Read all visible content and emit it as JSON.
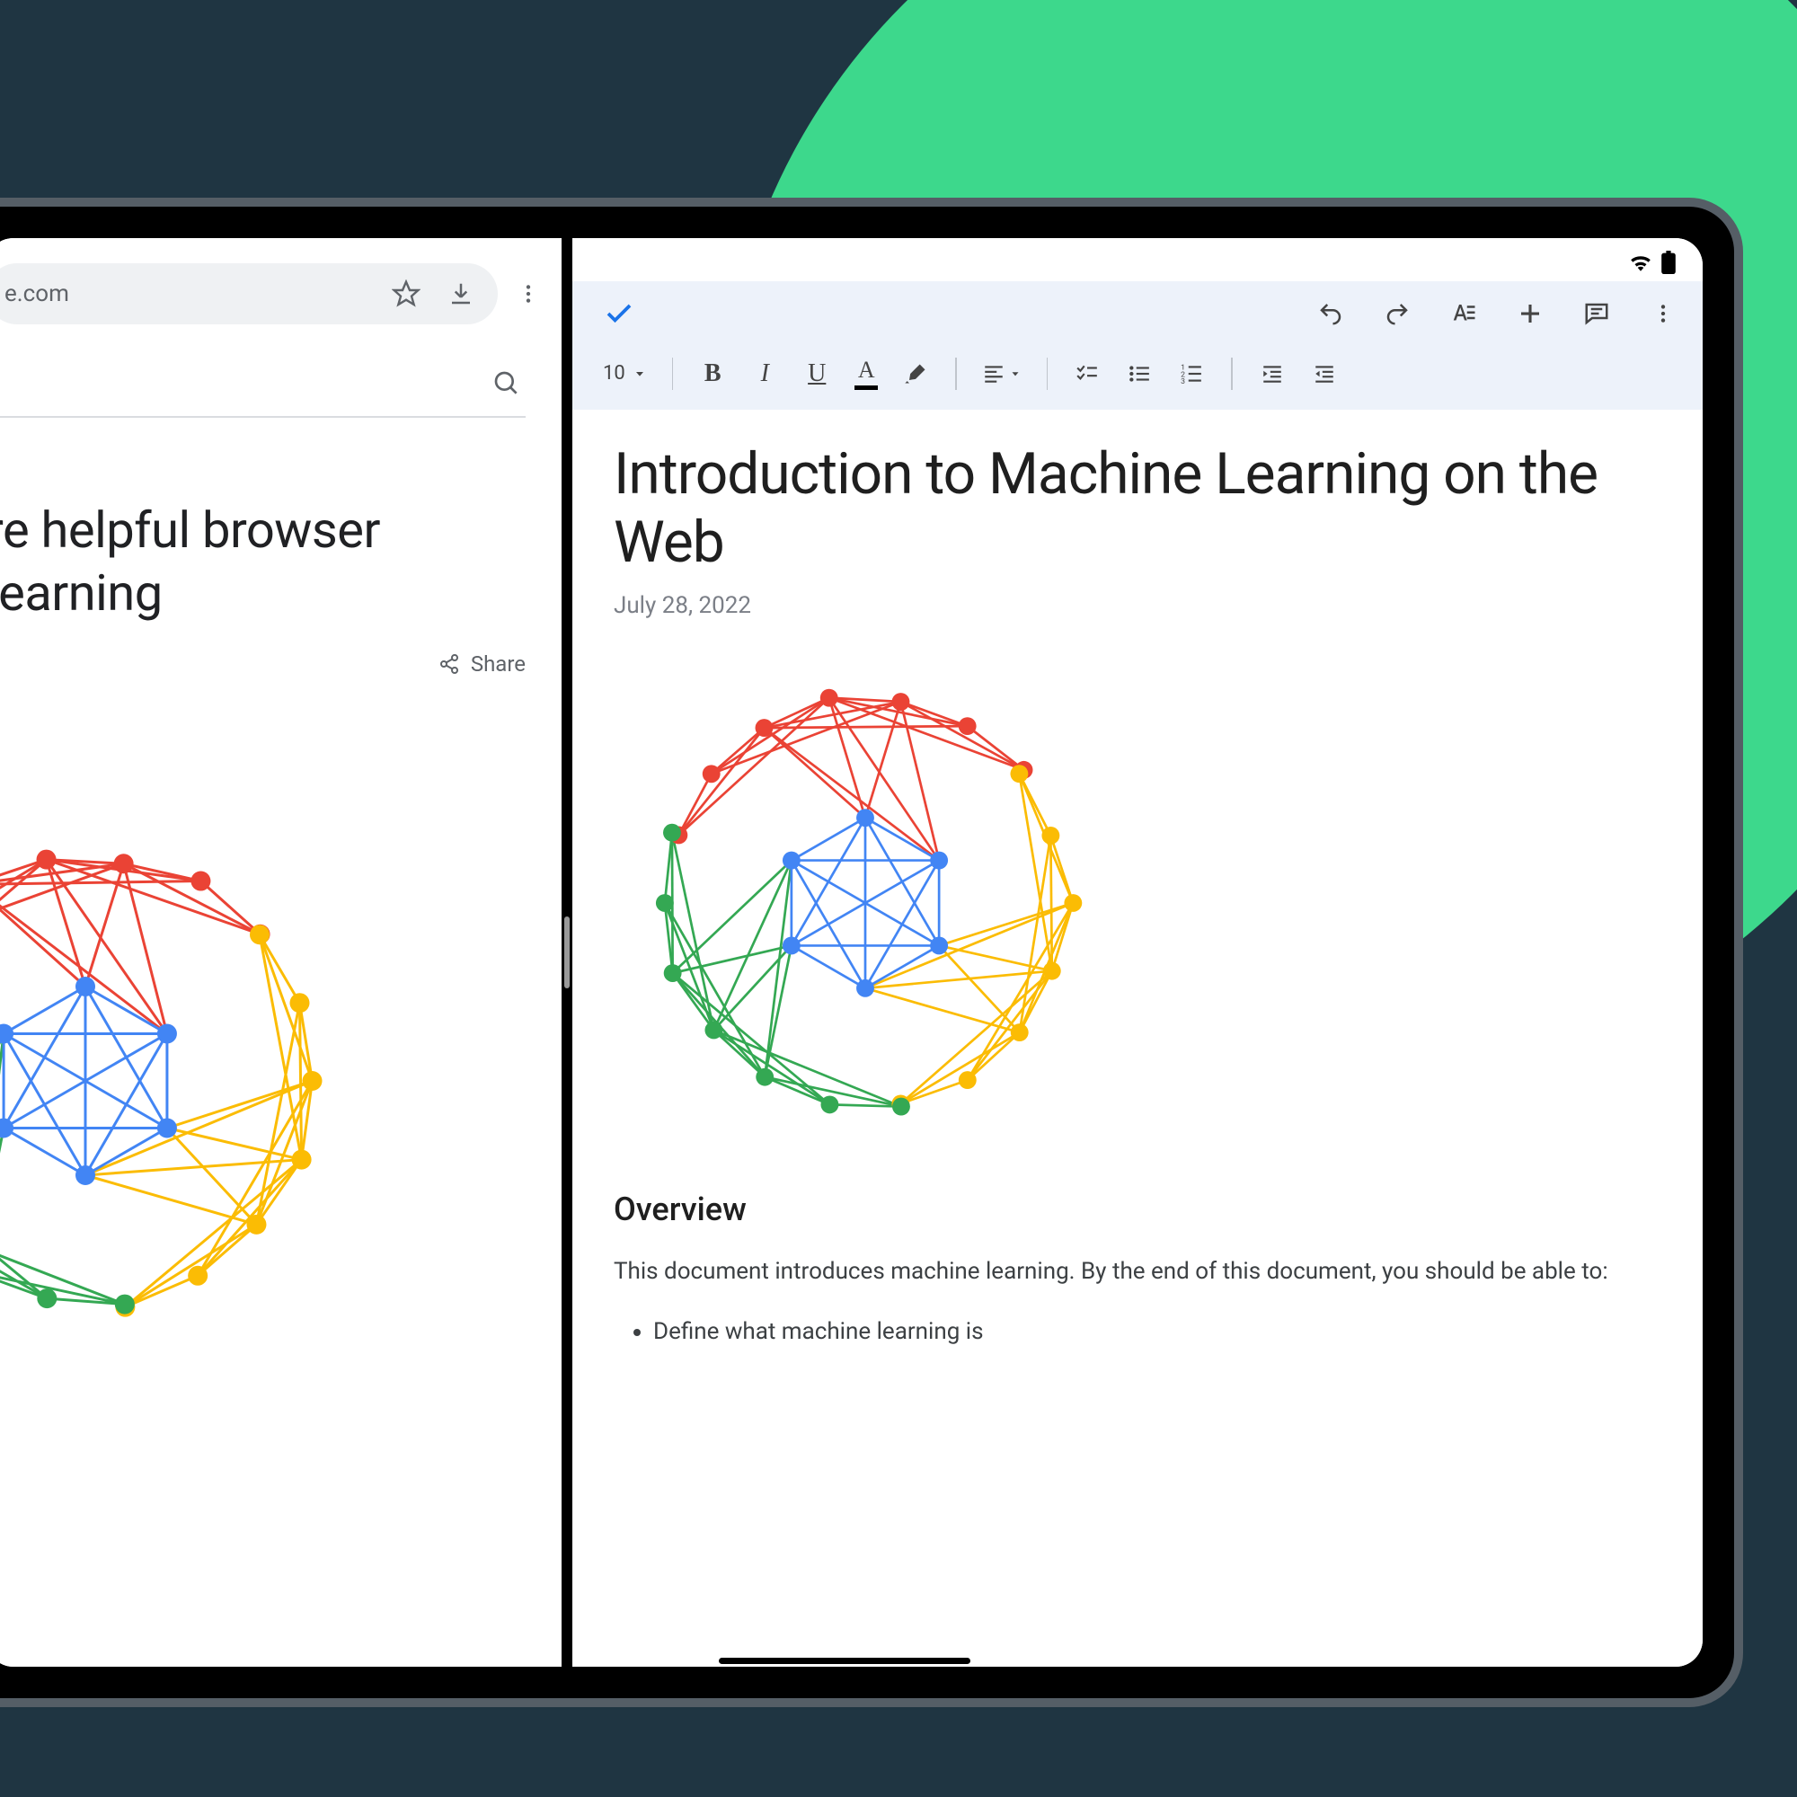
{
  "chrome": {
    "omnibox_text": "e.com",
    "article_title_line1": "re helpful browser",
    "article_title_line2": "learning",
    "share_label": "Share"
  },
  "docs": {
    "font_size": "10",
    "title": "Introduction to Machine Learning on the Web",
    "date": "July 28, 2022",
    "heading": "Overview",
    "paragraph": "This document introduces machine learning. By the end of this document, you should be able to:",
    "bullet1": "Define what machine learning is"
  },
  "colors": {
    "red": "#ea4335",
    "green": "#34a853",
    "yellow": "#fbbc04",
    "blue": "#4285f4"
  }
}
